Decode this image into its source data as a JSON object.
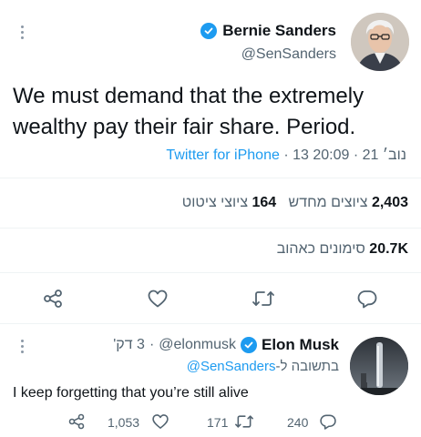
{
  "main_tweet": {
    "author_name": "Bernie Sanders",
    "author_handle": "@SenSanders",
    "text": "We must demand that the extremely wealthy pay their fair share. Period.",
    "source": "Twitter for iPhone",
    "date": "13 נוב׳ 21",
    "time": "20:09",
    "separator": "·",
    "stats": {
      "retweets_count": "2,403",
      "retweets_label": "ציוצים מחדש",
      "quotes_count": "164",
      "quotes_label": "ציוצי ציטוט",
      "likes_count": "20.7K",
      "likes_label": "סימונים כאהוב"
    }
  },
  "reply_tweet": {
    "author_name": "Elon Musk",
    "author_handle": "@elonmusk",
    "time_ago": "3 דק'",
    "separator": "·",
    "replying_prefix": "בתשובה ל-",
    "replying_handle": "@SenSanders",
    "text": "I keep forgetting that you’re still alive",
    "likes_count": "1,053",
    "retweets_count": "171",
    "replies_count": "240"
  },
  "icons": {
    "more": "more-icon",
    "verified": "verified-badge-icon",
    "share": "share-icon",
    "like": "heart-icon",
    "retweet": "retweet-icon",
    "reply": "reply-icon"
  },
  "colors": {
    "accent": "#1d9bf0",
    "secondary_text": "#536471",
    "divider": "#eff3f4"
  }
}
